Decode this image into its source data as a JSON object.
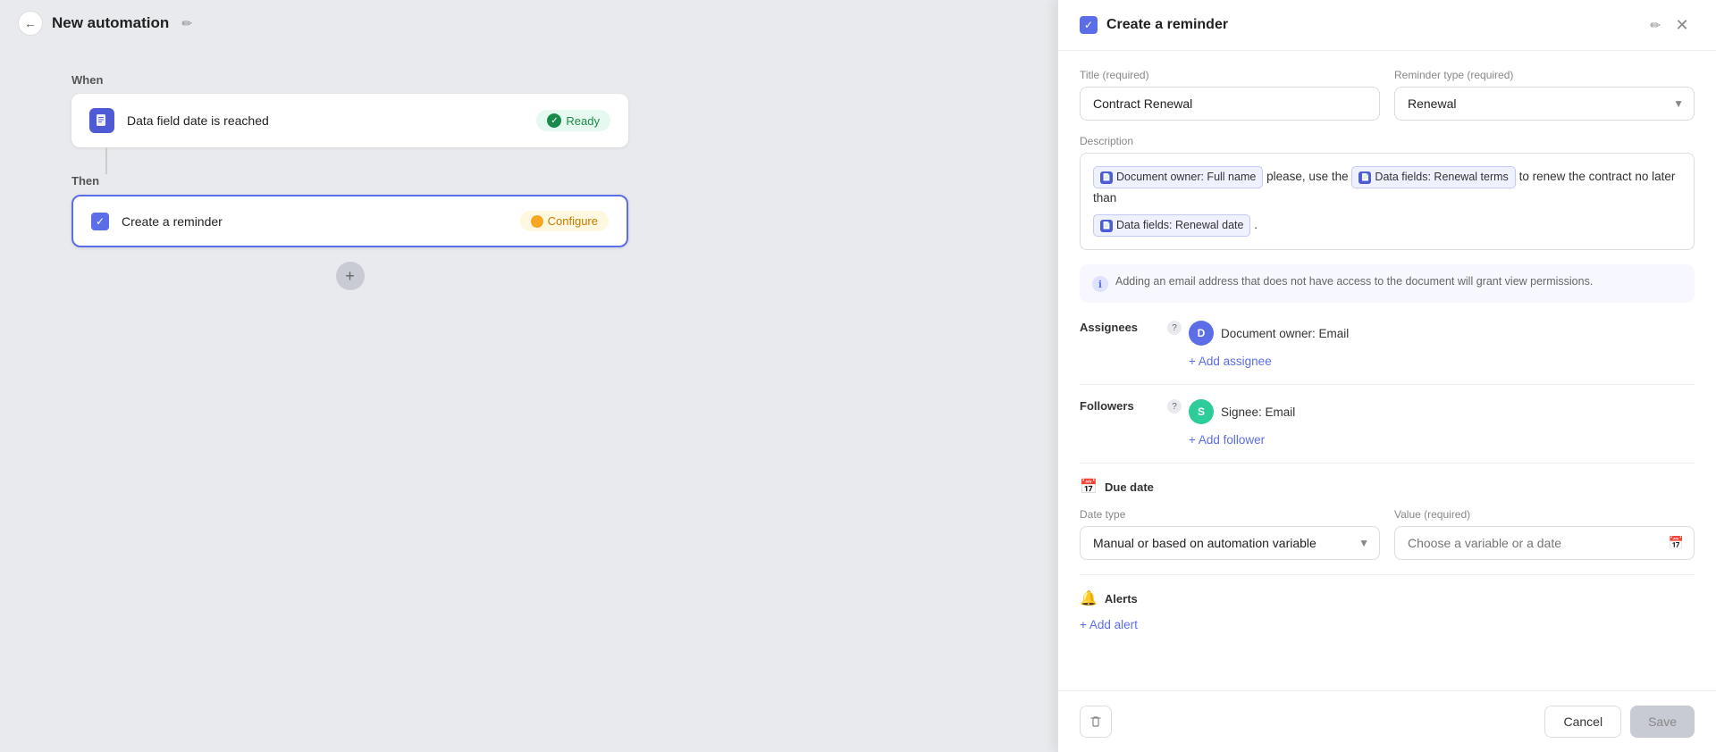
{
  "app": {
    "title": "New automation",
    "left_panel_bg": "#e8eaed"
  },
  "top_bar": {
    "back_label": "←",
    "title": "New automation",
    "edit_icon": "✏"
  },
  "when_section": {
    "label": "When",
    "trigger_text": "Data field date is reached",
    "status": "Ready",
    "doc_icon": "📄"
  },
  "then_section": {
    "label": "Then",
    "action_text": "Create a reminder",
    "status": "Configure"
  },
  "add_step": {
    "icon": "+"
  },
  "panel": {
    "title": "Create a reminder",
    "edit_icon": "✏",
    "close_icon": "✕",
    "checkbox_checked": "✓"
  },
  "form": {
    "title_label": "Title (required)",
    "title_value": "Contract Renewal",
    "title_placeholder": "Contract Renewal",
    "reminder_type_label": "Reminder type (required)",
    "reminder_type_value": "Renewal",
    "description_label": "Description",
    "description_parts": [
      {
        "type": "chip",
        "icon_label": "doc",
        "text": "Document owner: Full name"
      },
      {
        "type": "text",
        "text": " please, use the "
      },
      {
        "type": "chip",
        "icon_label": "doc",
        "text": "Data fields: Renewal terms"
      },
      {
        "type": "text",
        "text": " to renew the contract no later than"
      },
      {
        "type": "chip_newline",
        "icon_label": "doc",
        "text": "Data fields: Renewal date"
      },
      {
        "type": "text",
        "text": " ."
      }
    ],
    "info_banner_text": "Adding an email address that does not have access to the document will grant view permissions.",
    "assignees_label": "Assignees",
    "assignees_help": "?",
    "assignee_name": "Document owner: Email",
    "add_assignee_label": "+ Add assignee",
    "followers_label": "Followers",
    "followers_help": "?",
    "follower_name": "Signee: Email",
    "add_follower_label": "+ Add follower",
    "due_date_label": "Due date",
    "date_type_label": "Date type",
    "date_type_value": "Manual or based on automation variable",
    "value_label": "Value (required)",
    "value_placeholder": "Choose a variable or a date",
    "alerts_label": "Alerts",
    "add_alert_label": "+ Add alert"
  },
  "footer": {
    "cancel_label": "Cancel",
    "save_label": "Save"
  }
}
